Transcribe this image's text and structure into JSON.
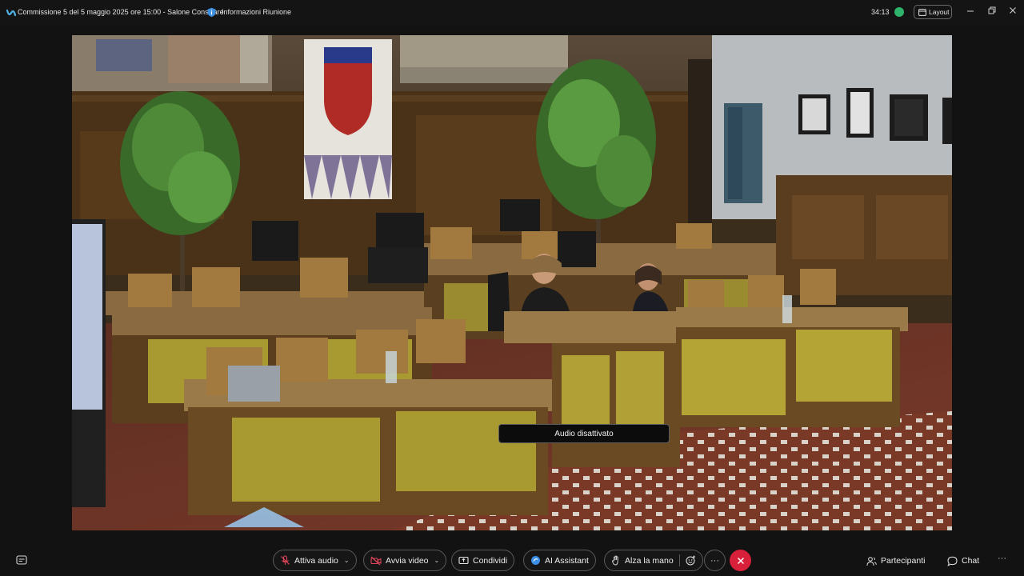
{
  "titlebar": {
    "meeting_title": "Commissione 5 del 5 maggio 2025 ore 15:00 - Salone Consiliare",
    "info_label": "Informazioni Riunione",
    "timer": "34:13",
    "layout_label": "Layout",
    "icons": [
      "webex-app-icon",
      "shield-info-icon",
      "status-dot",
      "layout-icon",
      "minimize-icon",
      "restore-icon",
      "close-icon"
    ]
  },
  "video": {
    "toast_text": "Audio disattivato"
  },
  "controls": {
    "audio_label": "Attiva audio",
    "video_label": "Avvia video",
    "share_label": "Condividi",
    "ai_label": "AI Assistant",
    "raise_hand_label": "Alza la mano",
    "more_label": "···",
    "participants_label": "Partecipanti",
    "chat_label": "Chat",
    "ellipsis_label": "···"
  },
  "colors": {
    "background": "#121212",
    "leave_red": "#d8203a",
    "muted_red": "#e0455a",
    "status_green": "#2fb36b",
    "ai_blue": "#3b8fe8"
  }
}
